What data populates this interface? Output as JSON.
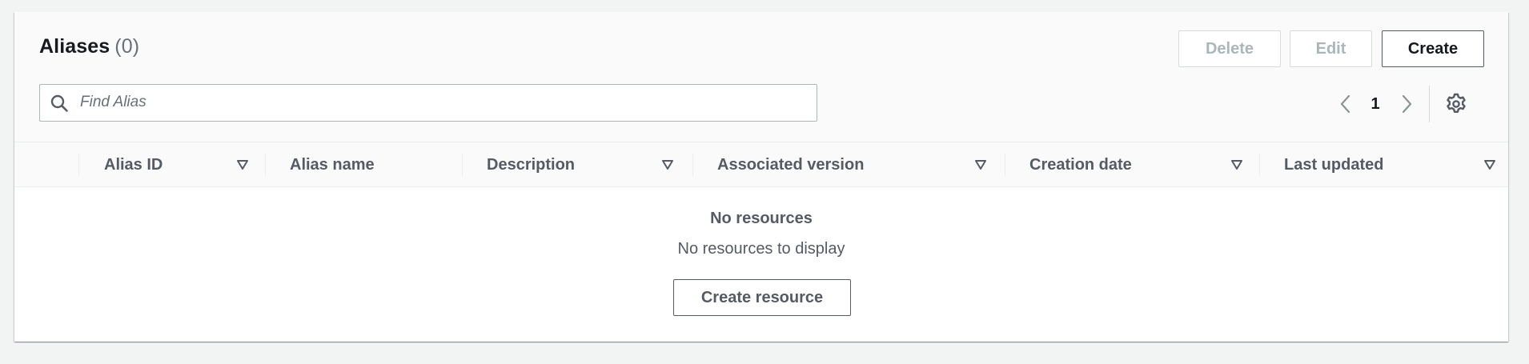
{
  "header": {
    "title": "Aliases",
    "count": "(0)"
  },
  "actions": {
    "delete_label": "Delete",
    "edit_label": "Edit",
    "create_label": "Create"
  },
  "search": {
    "placeholder": "Find Alias",
    "value": ""
  },
  "pagination": {
    "current_page": "1"
  },
  "table": {
    "columns": [
      {
        "label": "Alias ID",
        "sortable": true
      },
      {
        "label": "Alias name",
        "sortable": false
      },
      {
        "label": "Description",
        "sortable": true
      },
      {
        "label": "Associated version",
        "sortable": true
      },
      {
        "label": "Creation date",
        "sortable": true
      },
      {
        "label": "Last updated",
        "sortable": true
      }
    ],
    "rows": []
  },
  "empty_state": {
    "title": "No resources",
    "subtitle": "No resources to display",
    "button_label": "Create resource"
  },
  "icons": {
    "search": "search-icon",
    "prev": "chevron-left-icon",
    "next": "chevron-right-icon",
    "settings": "gear-icon",
    "sort": "sort-down-icon"
  },
  "colors": {
    "text_primary": "#16191f",
    "text_secondary": "#545b64",
    "disabled": "#aab7b8",
    "header_bg": "#fafafa",
    "page_bg": "#f2f3f3"
  }
}
